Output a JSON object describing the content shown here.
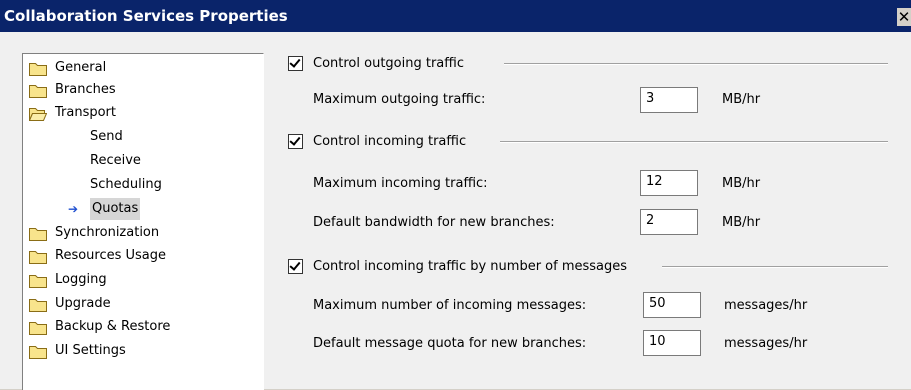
{
  "window": {
    "title": "Collaboration Services Properties",
    "close_glyph": "✕"
  },
  "tree": {
    "items": [
      {
        "label": "General"
      },
      {
        "label": "Branches"
      },
      {
        "label": "Transport"
      },
      {
        "label": "Send"
      },
      {
        "label": "Receive"
      },
      {
        "label": "Scheduling"
      },
      {
        "label": "Quotas"
      },
      {
        "label": "Synchronization"
      },
      {
        "label": "Resources Usage"
      },
      {
        "label": "Logging"
      },
      {
        "label": "Upgrade"
      },
      {
        "label": "Backup & Restore"
      },
      {
        "label": "UI Settings"
      }
    ],
    "selected_arrow": "➔"
  },
  "outgoing": {
    "checkbox_label": "Control outgoing traffic",
    "checked": true,
    "max_label": "Maximum outgoing traffic:",
    "max_value": "3",
    "max_unit": "MB/hr"
  },
  "incoming": {
    "checkbox_label": "Control incoming traffic",
    "checked": true,
    "max_label": "Maximum incoming traffic:",
    "max_value": "12",
    "max_unit": "MB/hr",
    "default_label": "Default bandwidth for new branches:",
    "default_value": "2",
    "default_unit": "MB/hr"
  },
  "messages": {
    "checkbox_label": "Control incoming traffic by number of messages",
    "checked": true,
    "max_label": "Maximum number of incoming messages:",
    "max_value": "50",
    "max_unit": "messages/hr",
    "default_label": "Default message quota for new branches:",
    "default_value": "10",
    "default_unit": "messages/hr"
  }
}
